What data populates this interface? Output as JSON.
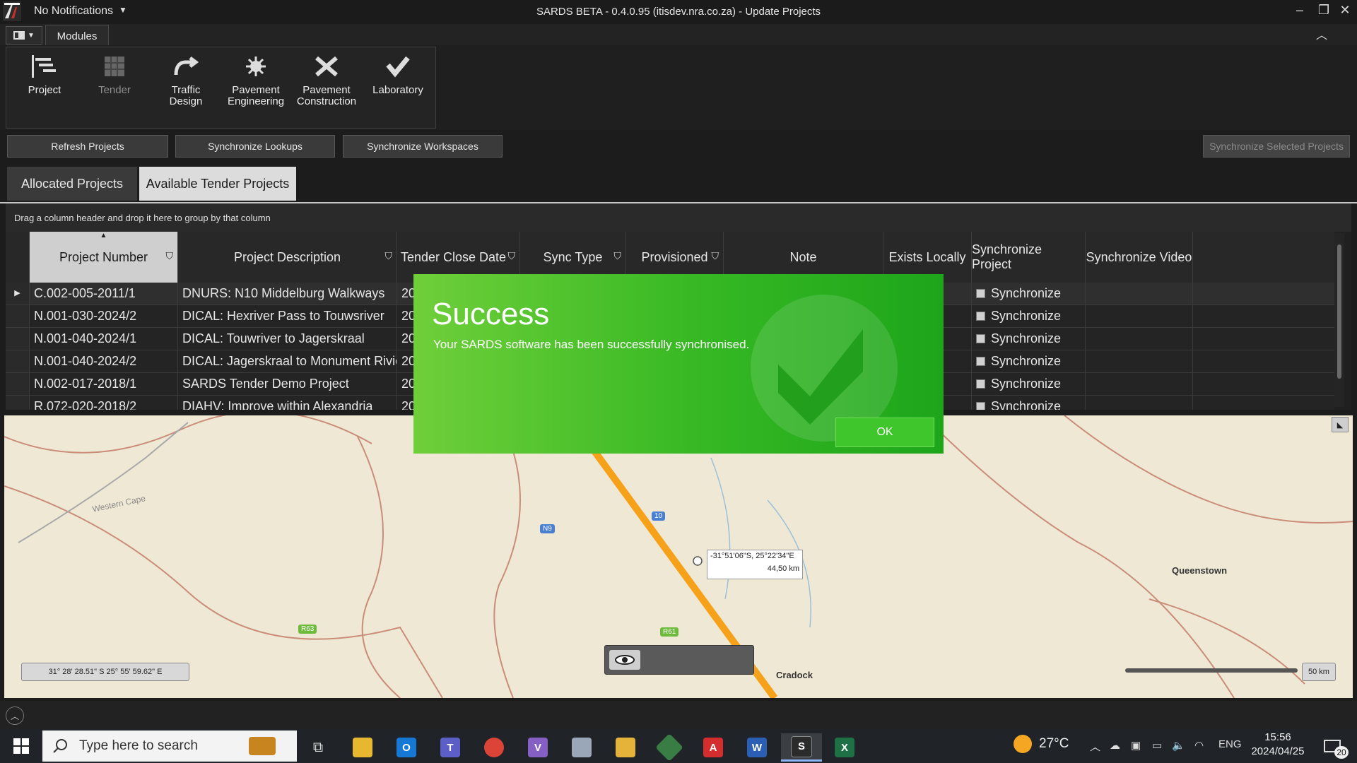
{
  "titlebar": {
    "notifications": "No Notifications",
    "title": "SARDS BETA - 0.4.0.95 (itisdev.nra.co.za) - Update Projects"
  },
  "ribbon": {
    "tab": "Modules",
    "modules": [
      {
        "label": "Project",
        "icon": "project-icon",
        "enabled": true
      },
      {
        "label": "Tender",
        "icon": "tender-icon",
        "enabled": false
      },
      {
        "label": "Traffic\nDesign",
        "icon": "traffic-design-icon",
        "enabled": true
      },
      {
        "label": "Pavement\nEngineering",
        "icon": "pavement-engineering-icon",
        "enabled": true
      },
      {
        "label": "Pavement\nConstruction",
        "icon": "pavement-construction-icon",
        "enabled": true
      },
      {
        "label": "Laboratory",
        "icon": "laboratory-icon",
        "enabled": true
      }
    ]
  },
  "actions": {
    "refresh": "Refresh Projects",
    "sync_lookups": "Synchronize Lookups",
    "sync_workspaces": "Synchronize Workspaces",
    "sync_selected": "Synchronize Selected Projects"
  },
  "tabs": {
    "allocated": "Allocated Projects",
    "available": "Available Tender Projects"
  },
  "group_panel": "Drag a column header and drop it here to group by that column",
  "grid": {
    "columns": [
      "Project Number",
      "Project Description",
      "Tender Close Date",
      "Sync Type",
      "Provisioned",
      "Note",
      "Exists Locally",
      "Synchronize Project",
      "Synchronize Video"
    ],
    "rows": [
      {
        "number": "C.002-005-2011/1",
        "description": "DNURS: N10 Middelburg Walkways",
        "date": "20",
        "sync": "Synchronize"
      },
      {
        "number": "N.001-030-2024/2",
        "description": "DICAL: Hexriver Pass to Touwsriver",
        "date": "20",
        "sync": "Synchronize"
      },
      {
        "number": "N.001-040-2024/1",
        "description": "DICAL: Touwriver to Jagerskraal",
        "date": "20",
        "sync": "Synchronize"
      },
      {
        "number": "N.001-040-2024/2",
        "description": "DICAL: Jagerskraal to Monument Rivier",
        "date": "20",
        "sync": "Synchronize"
      },
      {
        "number": "N.002-017-2018/1",
        "description": "SARDS Tender Demo Project",
        "date": "20",
        "sync": "Synchronize"
      },
      {
        "number": "R.072-020-2018/2",
        "description": "DIAHV: Improve within Alexandria",
        "date": "20",
        "sync": "Synchronize"
      }
    ]
  },
  "map": {
    "coordinates": "31° 28' 28.51\" S 25° 55' 59.62\" E",
    "tooltip_coord": "-31°51'06\"S, 25°22'34\"E",
    "tooltip_distance": "44,50 km",
    "scale": "50 km",
    "labels": {
      "queenstown": "Queenstown",
      "cradock": "Cradock",
      "western_cape": "Western Cape",
      "n9": "N9",
      "n10": "10",
      "r61": "R61",
      "r63": "R63"
    },
    "route_color": "#f5a11a"
  },
  "dialog": {
    "title": "Success",
    "message": "Your SARDS software has been successfully synchronised.",
    "ok": "OK"
  },
  "taskbar": {
    "search_placeholder": "Type here to search",
    "weather": "27°C",
    "language": "ENG",
    "time": "15:56",
    "date": "2024/04/25",
    "notification_count": "20"
  }
}
